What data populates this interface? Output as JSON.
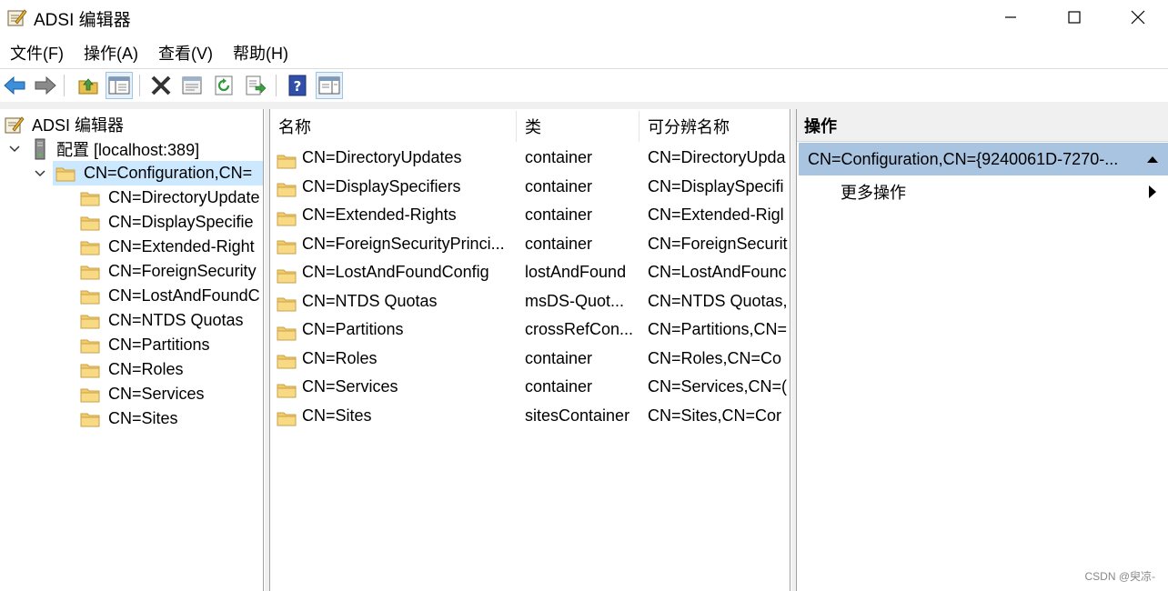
{
  "window": {
    "title": "ADSI 编辑器",
    "icon": "adsi-edit-icon"
  },
  "menu": [
    "文件(F)",
    "操作(A)",
    "查看(V)",
    "帮助(H)"
  ],
  "toolbar": {
    "buttons": [
      "back-icon",
      "forward-icon",
      "up-folder-icon",
      "show-hide-tree-icon",
      "delete-icon",
      "properties-icon",
      "refresh-icon",
      "export-list-icon",
      "help-icon",
      "show-hide-action-pane-icon"
    ]
  },
  "tree": {
    "root": "ADSI 编辑器",
    "connection": "配置 [localhost:389]",
    "selected": "CN=Configuration,CN=",
    "children": [
      "CN=DirectoryUpdate",
      "CN=DisplaySpecifie",
      "CN=Extended-Right",
      "CN=ForeignSecurity",
      "CN=LostAndFoundC",
      "CN=NTDS Quotas",
      "CN=Partitions",
      "CN=Roles",
      "CN=Services",
      "CN=Sites"
    ]
  },
  "list": {
    "headers": [
      "名称",
      "类",
      "可分辨名称"
    ],
    "rows": [
      {
        "name": "CN=DirectoryUpdates",
        "class": "container",
        "dn": "CN=DirectoryUpda"
      },
      {
        "name": "CN=DisplaySpecifiers",
        "class": "container",
        "dn": "CN=DisplaySpecifi"
      },
      {
        "name": "CN=Extended-Rights",
        "class": "container",
        "dn": "CN=Extended-Rigl"
      },
      {
        "name": "CN=ForeignSecurityPrinci...",
        "class": "container",
        "dn": "CN=ForeignSecurit"
      },
      {
        "name": "CN=LostAndFoundConfig",
        "class": "lostAndFound",
        "dn": "CN=LostAndFounc"
      },
      {
        "name": "CN=NTDS Quotas",
        "class": "msDS-Quot...",
        "dn": "CN=NTDS Quotas,"
      },
      {
        "name": "CN=Partitions",
        "class": "crossRefCon...",
        "dn": "CN=Partitions,CN="
      },
      {
        "name": "CN=Roles",
        "class": "container",
        "dn": "CN=Roles,CN=Co"
      },
      {
        "name": "CN=Services",
        "class": "container",
        "dn": "CN=Services,CN=("
      },
      {
        "name": "CN=Sites",
        "class": "sitesContainer",
        "dn": "CN=Sites,CN=Cor"
      }
    ]
  },
  "actions": {
    "header": "操作",
    "selected_item": "CN=Configuration,CN={9240061D-7270-...",
    "more": "更多操作"
  },
  "watermark": "CSDN @臾凉-"
}
